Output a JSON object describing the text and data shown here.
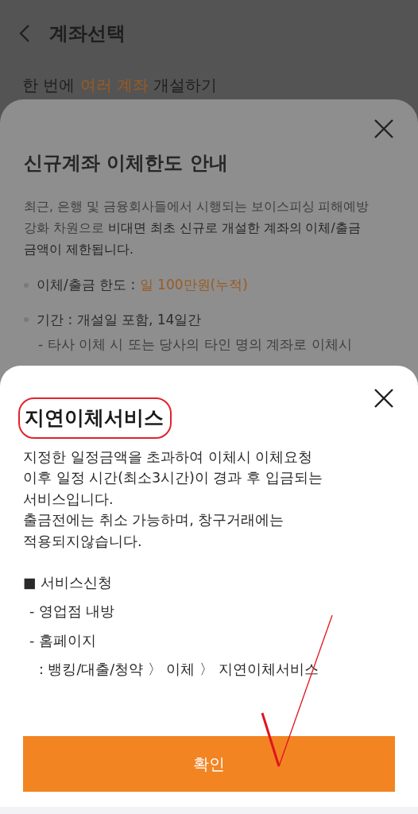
{
  "header": {
    "title": "계좌선택"
  },
  "intro": [
    {
      "text": "한 번에 ",
      "accent": false
    },
    {
      "text": "여러 계좌",
      "accent": true
    },
    {
      "text": " 개설하기",
      "accent": false
    }
  ],
  "back_sheet": {
    "title": "신규계좌 이체한도 안내",
    "paragraph": [
      {
        "text": "최근, 은행 및 금융회사들에서 시행되는 보이스피싱 피해예방 강화 차원으로 ",
        "strong": false
      },
      {
        "text": "비대면 최초 신규로 개설한 계좌의 이체/출금 금액이 제한됩니다.",
        "strong": true
      }
    ],
    "bullets": [
      {
        "label": "이체/출금 한도 : ",
        "value": "일 100만원(누적)",
        "accent": true
      },
      {
        "label": "기간 : ",
        "value": "개설일 포함, 14일간",
        "accent": false
      }
    ],
    "sub_note": "-  타사 이체 시 또는 당사의 타인 명의 계좌로 이체시"
  },
  "front_sheet": {
    "title": "지연이체서비스",
    "circled": true,
    "lines": [
      "지정한 일정금액을 초과하여 이체시 이체요청",
      "이후 일정 시간(최소3시간)이 경과 후 입금되는",
      "서비스입니다.",
      "출금전에는 취소 가능하며, 창구거래에는",
      "적용되지않습니다."
    ],
    "section": "■ 서비스신청",
    "items": [
      {
        "kind": "dash",
        "text": "- 영업점 내방"
      },
      {
        "kind": "dash",
        "text": "- 홈페이지"
      },
      {
        "kind": "path",
        "text": ": 뱅킹/대출/청약 〉 이체 〉 지연이체서비스"
      }
    ],
    "button": "확인"
  },
  "pen_mark": true
}
